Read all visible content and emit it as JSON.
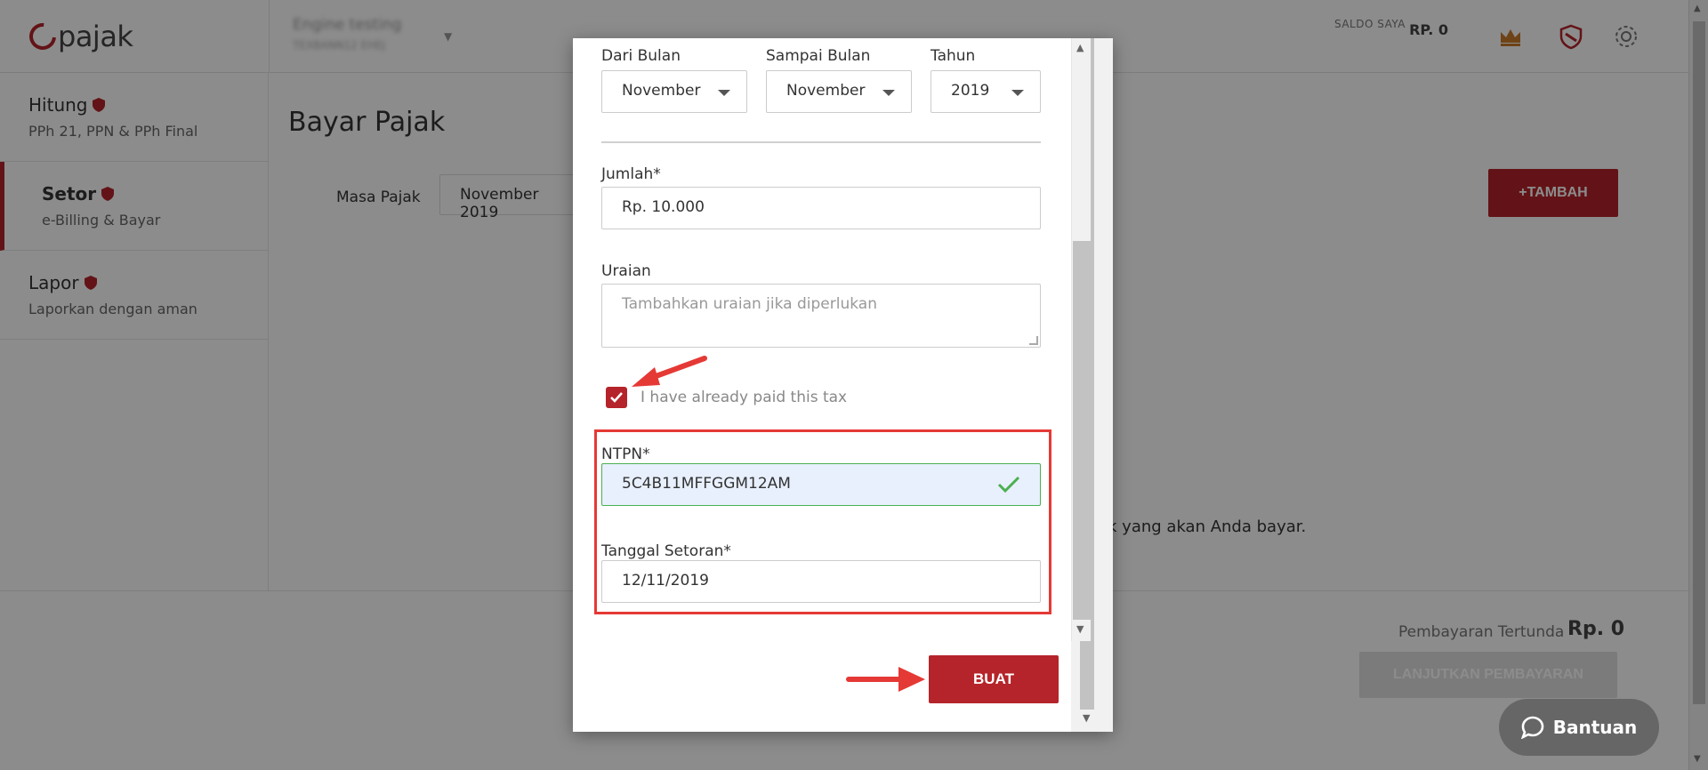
{
  "app": {
    "logo_text": "pajak",
    "company_name": "Engine testing",
    "company_sub": "TEXBANN12 EHEJ",
    "saldo_label": "SALDO SAYA",
    "saldo_value": "RP. 0"
  },
  "sidebar": {
    "items": [
      {
        "title": "Hitung",
        "subtitle": "PPh 21, PPN & PPh Final"
      },
      {
        "title": "Setor",
        "subtitle": "e-Billing & Bayar"
      },
      {
        "title": "Lapor",
        "subtitle": "Laporkan dengan aman"
      }
    ]
  },
  "main": {
    "title": "Bayar Pajak",
    "masa_label": "Masa Pajak",
    "masa_value": "November 2019",
    "tambah_label": "+TAMBAH",
    "hint": "ak yang akan Anda bayar."
  },
  "footer": {
    "pending_label": "Pembayaran Tertunda",
    "pending_value": "Rp. 0",
    "continue_label": "LANJUTKAN PEMBAYARAN",
    "help_label": "Bantuan"
  },
  "modal": {
    "dari_label": "Dari Bulan",
    "dari_value": "November",
    "sampai_label": "Sampai Bulan",
    "sampai_value": "November",
    "tahun_label": "Tahun",
    "tahun_value": "2019",
    "jumlah_label": "Jumlah*",
    "jumlah_value": "Rp. 10.000",
    "uraian_label": "Uraian",
    "uraian_placeholder": "Tambahkan uraian jika diperlukan",
    "paid_label": "I have already paid this tax",
    "paid_checked": true,
    "ntpn_label": "NTPN*",
    "ntpn_value": "5C4B11MFFGGM12AM",
    "tanggal_label": "Tanggal Setoran*",
    "tanggal_value": "12/11/2019",
    "buat_label": "BUAT"
  },
  "colors": {
    "brand": "#b5242a",
    "annotation": "#e53935",
    "valid": "#4caf50"
  }
}
